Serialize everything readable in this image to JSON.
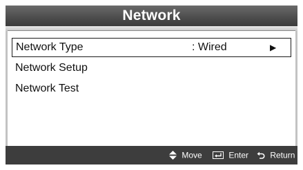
{
  "title": "Network",
  "menu": {
    "items": [
      {
        "label": "Network Type",
        "value": ": Wired",
        "arrow": "▶"
      },
      {
        "label": "Network Setup"
      },
      {
        "label": "Network Test"
      }
    ]
  },
  "footer": {
    "move_label": "Move",
    "enter_label": "Enter",
    "return_label": "Return"
  },
  "icons": {
    "move": "up-down-triangles-icon",
    "enter": "enter-key-icon",
    "return": "return-arrow-icon"
  },
  "colors": {
    "panel": "#c3c3c3",
    "title_bar": "#4c4c4c",
    "footer": "#3d3d3d",
    "content": "#ffffff"
  }
}
